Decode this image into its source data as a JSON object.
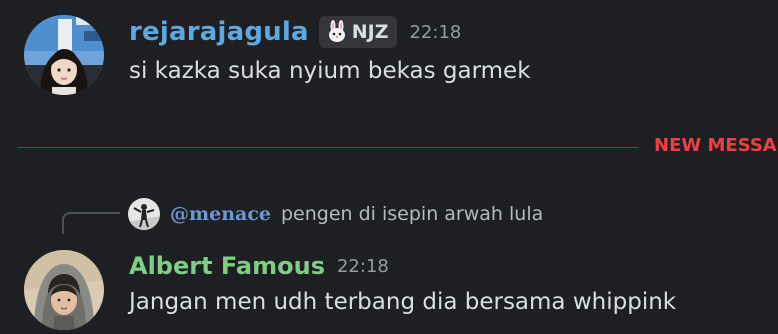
{
  "theme": {
    "background": "#1e1f22",
    "text": "#dbdee1",
    "muted_text": "#949ba4",
    "new_messages_red": "#f23f43"
  },
  "messages": [
    {
      "author": "rejarajagula",
      "author_color": "#5fa8df",
      "tag": {
        "icon": "bunny-icon",
        "label": "NJZ"
      },
      "timestamp": "22:18",
      "content": "si kazka suka nyium bekas garmek",
      "avatar": "user-avatar-girl"
    },
    {
      "author": "Albert Famous",
      "author_color": "#7ecf84",
      "timestamp": "22:18",
      "content": "Jangan men udh terbang dia bersama whippink",
      "avatar": "user-avatar-hoodie",
      "reply_to": {
        "author": "@menace",
        "content": "pengen di isepin arwah lula",
        "avatar": "reply-avatar-figure"
      }
    }
  ],
  "divider": {
    "label": "NEW MESSA"
  }
}
